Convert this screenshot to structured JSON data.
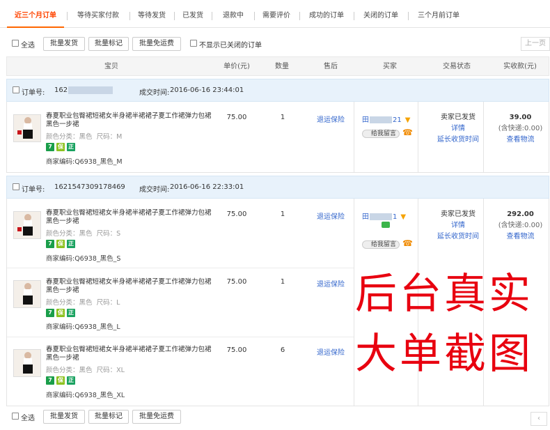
{
  "tabs": [
    "近三个月订单",
    "等待买家付款",
    "等待发货",
    "已发货",
    "退款中",
    "需要评价",
    "成功的订单",
    "关闭的订单",
    "三个月前订单"
  ],
  "toolbar": {
    "select_all": "全选",
    "batch_ship": "批量发货",
    "batch_mark": "批量标记",
    "batch_free_ship": "批量免运费",
    "hide_closed": "不显示已关闭的订单",
    "prev_page": "上一页"
  },
  "table_headers": {
    "product": "宝贝",
    "unit_price": "单价(元)",
    "qty": "数量",
    "after_sale": "售后",
    "buyer": "买家",
    "trade_status": "交易状态",
    "paid": "实收款(元)"
  },
  "labels": {
    "order_no": "订单号:",
    "deal_time": "成交时间:",
    "return_ins": "退运保险",
    "leave_msg": "给我留言",
    "shipped": "卖家已发货",
    "details": "详情",
    "extend": "延长收货时间",
    "view_logistics": "查看物流",
    "merchant_code": "商家编码:",
    "color_label": "颜色分类：",
    "size_label": "尺码：",
    "badge_7": "7",
    "badge_b": "保",
    "badge_z": "正"
  },
  "orders": [
    {
      "order_no": "162",
      "time": "2016-06-16 23:44:01",
      "buyer": "田",
      "buyer_tail": "21",
      "total": "39.00",
      "shipping_note": "(含快递:0.00)",
      "items": [
        {
          "name": "春夏职业包臀裙短裙女半身裙半裙裙子夏工作裙弹力包裙黑色一步裙",
          "color": "黑色",
          "size": "M",
          "code": "Q6938_黑色_M",
          "price": "75.00",
          "qty": "1"
        }
      ]
    },
    {
      "order_no": "1621547309178469",
      "time": "2016-06-16 22:33:01",
      "buyer": "田",
      "buyer_tail": "1",
      "total": "292.00",
      "shipping_note": "(含快递:0.00)",
      "items": [
        {
          "name": "春夏职业包臀裙短裙女半身裙半裙裙子夏工作裙弹力包裙黑色一步裙",
          "color": "黑色",
          "size": "S",
          "code": "Q6938_黑色_S",
          "price": "75.00",
          "qty": "1"
        },
        {
          "name": "春夏职业包臀裙短裙女半身裙半裙裙子夏工作裙弹力包裙黑色一步裙",
          "color": "黑色",
          "size": "L",
          "code": "Q6938_黑色_L",
          "price": "75.00",
          "qty": "1"
        },
        {
          "name": "春夏职业包臀裙短裙女半身裙半裙裙子夏工作裙弹力包裙黑色一步裙",
          "color": "黑色",
          "size": "XL",
          "code": "Q6938_黑色_XL",
          "price": "75.00",
          "qty": "6"
        }
      ]
    }
  ],
  "watermark": {
    "line1": "后台真实",
    "line2": "大单截图"
  },
  "colors": {
    "accent": "#ff6600",
    "link": "#3366cc",
    "watermark": "#e8000f",
    "badge_7": "#1a9e4a",
    "badge_b": "#8dc21f",
    "badge_z": "#1aa260"
  },
  "icons": {
    "flag": "flag-icon",
    "phone": "phone-icon",
    "chat": "chat-icon",
    "msg": "message-icon"
  }
}
